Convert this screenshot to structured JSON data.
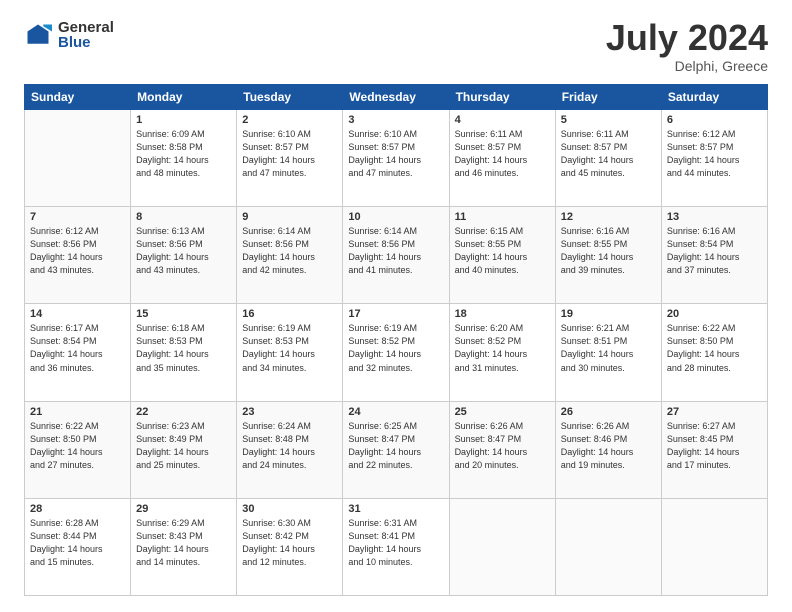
{
  "logo": {
    "general": "General",
    "blue": "Blue"
  },
  "header": {
    "month": "July 2024",
    "location": "Delphi, Greece"
  },
  "days_of_week": [
    "Sunday",
    "Monday",
    "Tuesday",
    "Wednesday",
    "Thursday",
    "Friday",
    "Saturday"
  ],
  "weeks": [
    [
      {
        "num": "",
        "info": ""
      },
      {
        "num": "1",
        "info": "Sunrise: 6:09 AM\nSunset: 8:58 PM\nDaylight: 14 hours\nand 48 minutes."
      },
      {
        "num": "2",
        "info": "Sunrise: 6:10 AM\nSunset: 8:57 PM\nDaylight: 14 hours\nand 47 minutes."
      },
      {
        "num": "3",
        "info": "Sunrise: 6:10 AM\nSunset: 8:57 PM\nDaylight: 14 hours\nand 47 minutes."
      },
      {
        "num": "4",
        "info": "Sunrise: 6:11 AM\nSunset: 8:57 PM\nDaylight: 14 hours\nand 46 minutes."
      },
      {
        "num": "5",
        "info": "Sunrise: 6:11 AM\nSunset: 8:57 PM\nDaylight: 14 hours\nand 45 minutes."
      },
      {
        "num": "6",
        "info": "Sunrise: 6:12 AM\nSunset: 8:57 PM\nDaylight: 14 hours\nand 44 minutes."
      }
    ],
    [
      {
        "num": "7",
        "info": "Sunrise: 6:12 AM\nSunset: 8:56 PM\nDaylight: 14 hours\nand 43 minutes."
      },
      {
        "num": "8",
        "info": "Sunrise: 6:13 AM\nSunset: 8:56 PM\nDaylight: 14 hours\nand 43 minutes."
      },
      {
        "num": "9",
        "info": "Sunrise: 6:14 AM\nSunset: 8:56 PM\nDaylight: 14 hours\nand 42 minutes."
      },
      {
        "num": "10",
        "info": "Sunrise: 6:14 AM\nSunset: 8:56 PM\nDaylight: 14 hours\nand 41 minutes."
      },
      {
        "num": "11",
        "info": "Sunrise: 6:15 AM\nSunset: 8:55 PM\nDaylight: 14 hours\nand 40 minutes."
      },
      {
        "num": "12",
        "info": "Sunrise: 6:16 AM\nSunset: 8:55 PM\nDaylight: 14 hours\nand 39 minutes."
      },
      {
        "num": "13",
        "info": "Sunrise: 6:16 AM\nSunset: 8:54 PM\nDaylight: 14 hours\nand 37 minutes."
      }
    ],
    [
      {
        "num": "14",
        "info": "Sunrise: 6:17 AM\nSunset: 8:54 PM\nDaylight: 14 hours\nand 36 minutes."
      },
      {
        "num": "15",
        "info": "Sunrise: 6:18 AM\nSunset: 8:53 PM\nDaylight: 14 hours\nand 35 minutes."
      },
      {
        "num": "16",
        "info": "Sunrise: 6:19 AM\nSunset: 8:53 PM\nDaylight: 14 hours\nand 34 minutes."
      },
      {
        "num": "17",
        "info": "Sunrise: 6:19 AM\nSunset: 8:52 PM\nDaylight: 14 hours\nand 32 minutes."
      },
      {
        "num": "18",
        "info": "Sunrise: 6:20 AM\nSunset: 8:52 PM\nDaylight: 14 hours\nand 31 minutes."
      },
      {
        "num": "19",
        "info": "Sunrise: 6:21 AM\nSunset: 8:51 PM\nDaylight: 14 hours\nand 30 minutes."
      },
      {
        "num": "20",
        "info": "Sunrise: 6:22 AM\nSunset: 8:50 PM\nDaylight: 14 hours\nand 28 minutes."
      }
    ],
    [
      {
        "num": "21",
        "info": "Sunrise: 6:22 AM\nSunset: 8:50 PM\nDaylight: 14 hours\nand 27 minutes."
      },
      {
        "num": "22",
        "info": "Sunrise: 6:23 AM\nSunset: 8:49 PM\nDaylight: 14 hours\nand 25 minutes."
      },
      {
        "num": "23",
        "info": "Sunrise: 6:24 AM\nSunset: 8:48 PM\nDaylight: 14 hours\nand 24 minutes."
      },
      {
        "num": "24",
        "info": "Sunrise: 6:25 AM\nSunset: 8:47 PM\nDaylight: 14 hours\nand 22 minutes."
      },
      {
        "num": "25",
        "info": "Sunrise: 6:26 AM\nSunset: 8:47 PM\nDaylight: 14 hours\nand 20 minutes."
      },
      {
        "num": "26",
        "info": "Sunrise: 6:26 AM\nSunset: 8:46 PM\nDaylight: 14 hours\nand 19 minutes."
      },
      {
        "num": "27",
        "info": "Sunrise: 6:27 AM\nSunset: 8:45 PM\nDaylight: 14 hours\nand 17 minutes."
      }
    ],
    [
      {
        "num": "28",
        "info": "Sunrise: 6:28 AM\nSunset: 8:44 PM\nDaylight: 14 hours\nand 15 minutes."
      },
      {
        "num": "29",
        "info": "Sunrise: 6:29 AM\nSunset: 8:43 PM\nDaylight: 14 hours\nand 14 minutes."
      },
      {
        "num": "30",
        "info": "Sunrise: 6:30 AM\nSunset: 8:42 PM\nDaylight: 14 hours\nand 12 minutes."
      },
      {
        "num": "31",
        "info": "Sunrise: 6:31 AM\nSunset: 8:41 PM\nDaylight: 14 hours\nand 10 minutes."
      },
      {
        "num": "",
        "info": ""
      },
      {
        "num": "",
        "info": ""
      },
      {
        "num": "",
        "info": ""
      }
    ]
  ]
}
